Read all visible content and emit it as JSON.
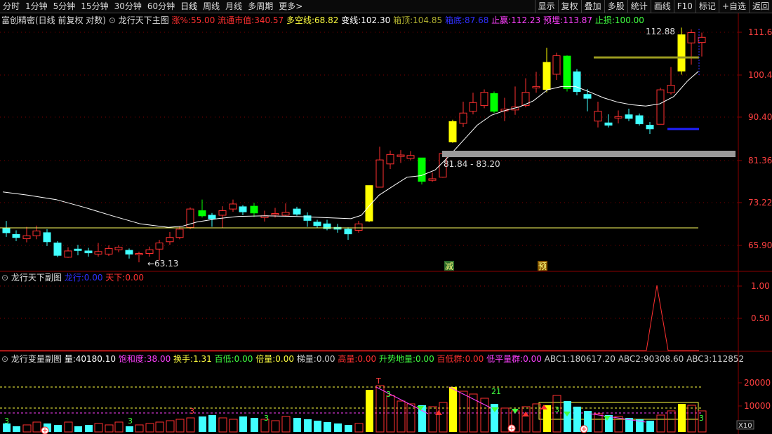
{
  "toolbar": {
    "periods": [
      "分时",
      "1分钟",
      "5分钟",
      "15分钟",
      "30分钟",
      "60分钟",
      "日线",
      "周线",
      "月线",
      "多周期",
      "更多>"
    ],
    "active_period": "日线",
    "right_buttons": [
      "显示",
      "复权",
      "叠加",
      "多股",
      "统计",
      "画线",
      "F10",
      "标记",
      "+自选",
      "返回"
    ]
  },
  "main_panel": {
    "stock_title": "富创精密(日线 前复权 对数)",
    "indicator_name": "龙行天下主图",
    "params": [
      {
        "label": "涨%:",
        "value": "55.00",
        "color": "#ff3030"
      },
      {
        "label": "流通市值:",
        "value": "340.57",
        "color": "#ff3030"
      },
      {
        "label": "多空线:",
        "value": "68.82",
        "color": "#ffff40"
      },
      {
        "label": "变线:",
        "value": "102.30",
        "color": "#ffffff"
      },
      {
        "label": "箱顶:",
        "value": "104.85",
        "color": "#b0b030"
      },
      {
        "label": "箱底:",
        "value": "87.68",
        "color": "#3030ff"
      },
      {
        "label": "止赢:",
        "value": "112.23",
        "color": "#ff40ff"
      },
      {
        "label": "预埋:",
        "value": "113.87",
        "color": "#ff40ff"
      },
      {
        "label": "止损:",
        "value": "100.00",
        "color": "#40ff40"
      }
    ],
    "price_ticks": [
      "111.6",
      "100.4",
      "90.40",
      "81.36",
      "73.22",
      "65.90"
    ],
    "annotations": {
      "low_label": "←63.13",
      "high_label": "112.88",
      "box_label": "81.84 - 83.20",
      "signal_jian": "减",
      "signal_yu": "预"
    }
  },
  "sub_panel": {
    "indicator_name": "龙行天下副图",
    "params": [
      {
        "label": "龙行:",
        "value": "0.00",
        "color": "#3030ff"
      },
      {
        "label": "天下:",
        "value": "0.00",
        "color": "#ff3030"
      }
    ],
    "ticks": [
      "1.00",
      "0.50"
    ]
  },
  "vol_panel": {
    "indicator_name": "龙行变量副图",
    "params": [
      {
        "label": "量:",
        "value": "40180.10",
        "color": "#ffffff"
      },
      {
        "label": "饱和度:",
        "value": "38.00",
        "color": "#ff40ff"
      },
      {
        "label": "换手:",
        "value": "1.31",
        "color": "#ffff40"
      },
      {
        "label": "百低:",
        "value": "0.00",
        "color": "#40ff40"
      },
      {
        "label": "倍量:",
        "value": "0.00",
        "color": "#ffff40"
      },
      {
        "label": "梯量:",
        "value": "0.00",
        "color": "#cccccc"
      },
      {
        "label": "高量:",
        "value": "0.00",
        "color": "#ff3030"
      },
      {
        "label": "升势地量:",
        "value": "0.00",
        "color": "#40ff40"
      },
      {
        "label": "百低群:",
        "value": "0.00",
        "color": "#ff3030"
      },
      {
        "label": "低平量群:",
        "value": "0.00",
        "color": "#ff40ff"
      },
      {
        "label": "ABC1:",
        "value": "180617.20",
        "color": "#cccccc"
      },
      {
        "label": "ABC2:",
        "value": "90308.60",
        "color": "#cccccc"
      },
      {
        "label": "ABC3:",
        "value": "112852",
        "color": "#cccccc"
      }
    ],
    "ticks": [
      "20000",
      "10000"
    ],
    "unit_label": "X10",
    "markers": [
      "T",
      "3",
      "21",
      "3",
      "3",
      "3",
      "3",
      "3",
      "3"
    ]
  },
  "colors": {
    "up": "#ff3030",
    "down": "#40ffff",
    "yellow": "#ffff00",
    "green": "#00ff00",
    "grid": "#8b0000",
    "ma": "#ffffff",
    "baseline": "#ffff60"
  }
}
